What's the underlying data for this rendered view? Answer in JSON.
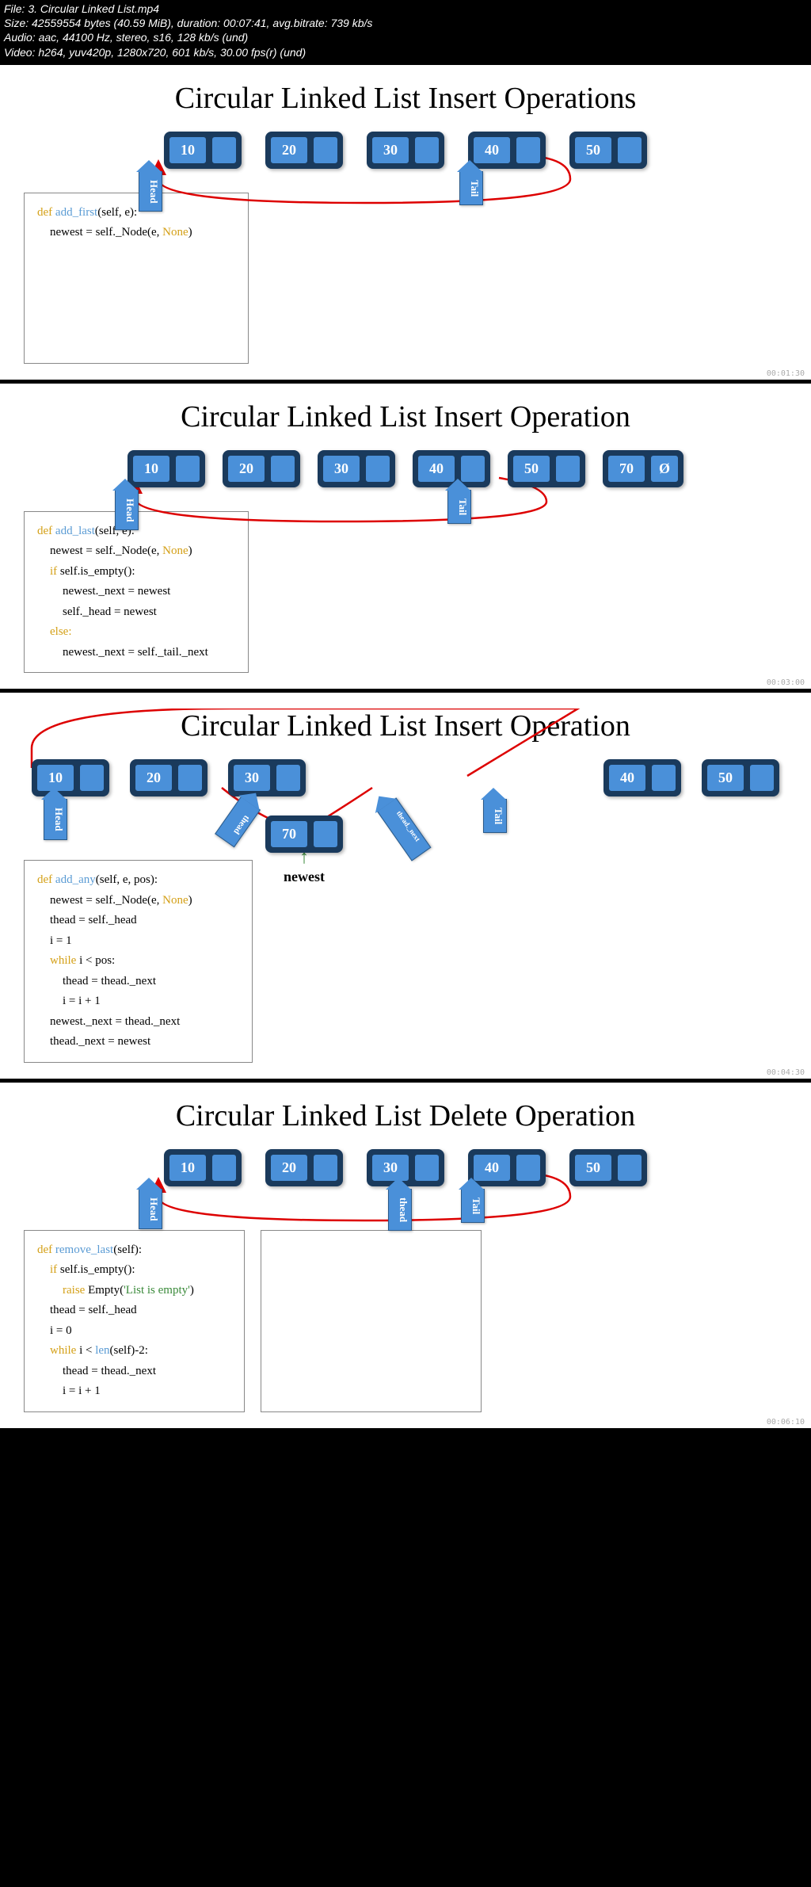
{
  "meta": {
    "file": "File: 3. Circular Linked List.mp4",
    "size": "Size: 42559554 bytes (40.59 MiB), duration: 00:07:41, avg.bitrate: 739 kb/s",
    "audio": "Audio: aac, 44100 Hz, stereo, s16, 128 kb/s (und)",
    "video": "Video: h264, yuv420p, 1280x720, 601 kb/s, 30.00 fps(r) (und)"
  },
  "slide1": {
    "title": "Circular Linked List Insert Operations",
    "nodes": [
      "10",
      "20",
      "30",
      "40",
      "50"
    ],
    "head": "Head",
    "tail": "Tail",
    "code": {
      "l1_def": "def ",
      "l1_fn": "add_first",
      "l1_rest": "(self, e):",
      "l2a": "newest = self._Node(e, ",
      "l2_none": "None",
      "l2b": ")"
    },
    "ts": "00:01:30"
  },
  "slide2": {
    "title": "Circular Linked List Insert Operation",
    "nodes": [
      "10",
      "20",
      "30",
      "40",
      "50",
      "70"
    ],
    "nullsym": "Ø",
    "head": "Head",
    "tail": "Tail",
    "code": {
      "l1_def": "def ",
      "l1_fn": "add_last",
      "l1_rest": "(self, e):",
      "l2a": "newest = self._Node(e, ",
      "l2_none": "None",
      "l2b": ")",
      "l3_if": "if ",
      "l3": "self.is_empty():",
      "l4": "newest._next = newest",
      "l5": "self._head = newest",
      "l6_else": "else:",
      "l7": "newest._next = self._tail._next"
    },
    "ts": "00:03:00"
  },
  "slide3": {
    "title": "Circular Linked List Insert Operation",
    "nodes_left": [
      "10",
      "20",
      "30"
    ],
    "nodes_right": [
      "40",
      "50"
    ],
    "newest_val": "70",
    "newest_label": "newest",
    "head": "Head",
    "tail": "Tail",
    "thead": "thead",
    "thead_next": "thead._next",
    "code": {
      "l1_def": "def ",
      "l1_fn": "add_any",
      "l1_rest": "(self, e, pos):",
      "l2a": "newest = self._Node(e, ",
      "l2_none": "None",
      "l2b": ")",
      "l3": "thead = self._head",
      "l4": "i = 1",
      "l5_while": "while ",
      "l5": "i < pos:",
      "l6": "thead = thead._next",
      "l7": "i = i + 1",
      "l8": "newest._next = thead._next",
      "l9": "thead._next = newest"
    },
    "ts": "00:04:30"
  },
  "slide4": {
    "title": "Circular Linked List Delete Operation",
    "nodes": [
      "10",
      "20",
      "30",
      "40",
      "50"
    ],
    "head": "Head",
    "tail": "Tail",
    "thead": "thead",
    "code": {
      "l1_def": "def ",
      "l1_fn": "remove_last",
      "l1_rest": "(self):",
      "l2_if": "if ",
      "l2": "self.is_empty():",
      "l3_raise": "raise ",
      "l3a": "Empty(",
      "l3_str": "'List is empty'",
      "l3b": ")",
      "l4": "thead = self._head",
      "l5": "i = 0",
      "l6_while": "while ",
      "l6a": "i < ",
      "l6_len": "len",
      "l6b": "(self)-2:",
      "l7": "thead = thead._next",
      "l8": "i = i + 1"
    },
    "ts": "00:06:10"
  }
}
